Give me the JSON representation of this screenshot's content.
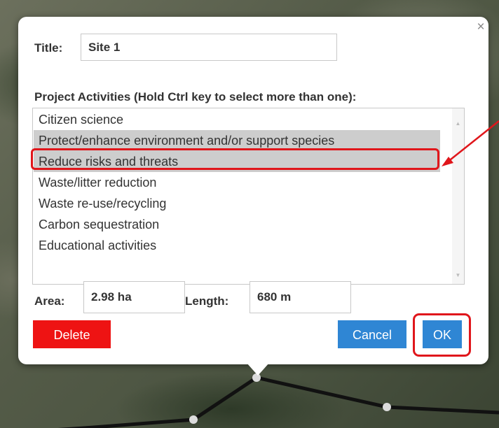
{
  "dialog": {
    "title_label": "Title:",
    "title_value": "Site 1",
    "activities_label": "Project Activities (Hold Ctrl key to select more than one):",
    "activities": [
      {
        "label": "Citizen science",
        "selected": false
      },
      {
        "label": "Protect/enhance environment and/or support species",
        "selected": true
      },
      {
        "label": "Reduce risks and threats",
        "selected": true
      },
      {
        "label": "Waste/litter reduction",
        "selected": false
      },
      {
        "label": "Waste re-use/recycling",
        "selected": false
      },
      {
        "label": "Carbon sequestration",
        "selected": false
      },
      {
        "label": "Educational activities",
        "selected": false
      }
    ],
    "area_label": "Area:",
    "area_value": "2.98 ha",
    "length_label": "Length:",
    "length_value": "680 m",
    "close_glyph": "×",
    "buttons": {
      "delete": "Delete",
      "cancel": "Cancel",
      "ok": "OK"
    }
  },
  "listbox_scroll": {
    "up_glyph": "▲",
    "down_glyph": "▼"
  },
  "colors": {
    "delete": "#ee1313",
    "primary": "#2f86d4",
    "selected_row": "#cdcdcd",
    "annotation": "#e0161b"
  }
}
